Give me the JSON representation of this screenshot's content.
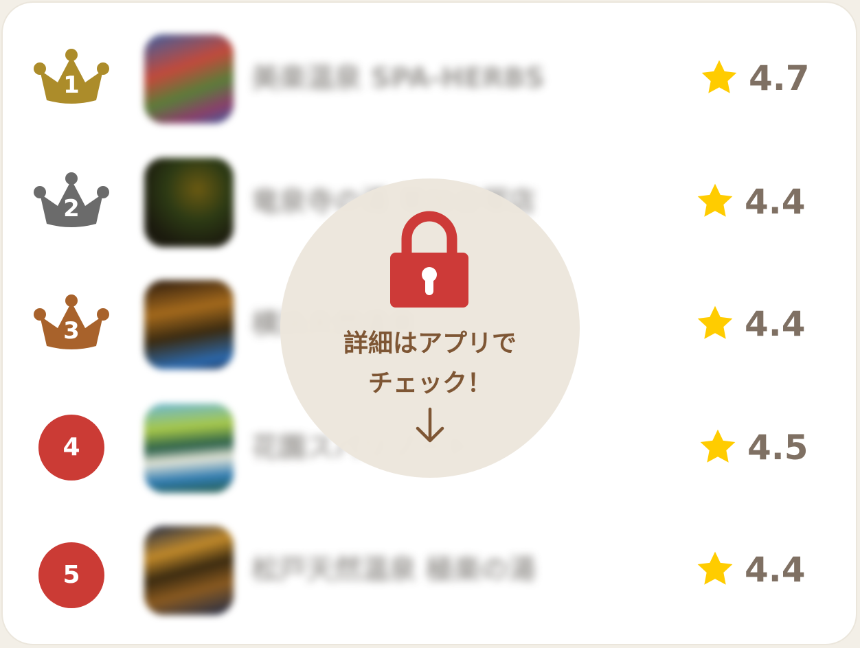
{
  "ranking": [
    {
      "rank": "1",
      "badge": "crown-gold",
      "badge_color": "#ac8c2a",
      "name": "美楽温泉 SPA-HERBS",
      "rating": "4.7",
      "thumb_colors": [
        "#3d5fa1",
        "#c24a3b",
        "#5a7d3a"
      ]
    },
    {
      "rank": "2",
      "badge": "crown-silver",
      "badge_color": "#6b6b6b",
      "name": "竜泉寺の湯 草加谷塚店",
      "rating": "4.4",
      "thumb_colors": [
        "#1b1a0e",
        "#6b5a12",
        "#2c3a14"
      ]
    },
    {
      "rank": "3",
      "badge": "crown-bronze",
      "badge_color": "#a8622b",
      "name": "横浜天然温泉",
      "rating": "4.4",
      "thumb_colors": [
        "#2a1a0e",
        "#a56a1c",
        "#2b6ab0"
      ]
    },
    {
      "rank": "4",
      "badge": "circle",
      "badge_color": "#cb3b35",
      "name": "花園スパリゾート",
      "rating": "4.5",
      "thumb_colors": [
        "#6ab7d8",
        "#2a5f4a",
        "#e6e6d8"
      ]
    },
    {
      "rank": "5",
      "badge": "circle",
      "badge_color": "#cb3b35",
      "name": "松戸天然温泉 極楽の湯",
      "rating": "4.4",
      "thumb_colors": [
        "#1d2a4a",
        "#8a5a20",
        "#c28a2a"
      ]
    }
  ],
  "overlay": {
    "line1": "詳細はアプリで",
    "line2": "チェック！",
    "lock_icon": "lock-icon",
    "arrow_icon": "arrow-down-icon"
  },
  "colors": {
    "star": "#ffcc00",
    "rating_text": "#7f7063",
    "lock": "#cd3a38",
    "overlay_text": "#7e5634"
  }
}
